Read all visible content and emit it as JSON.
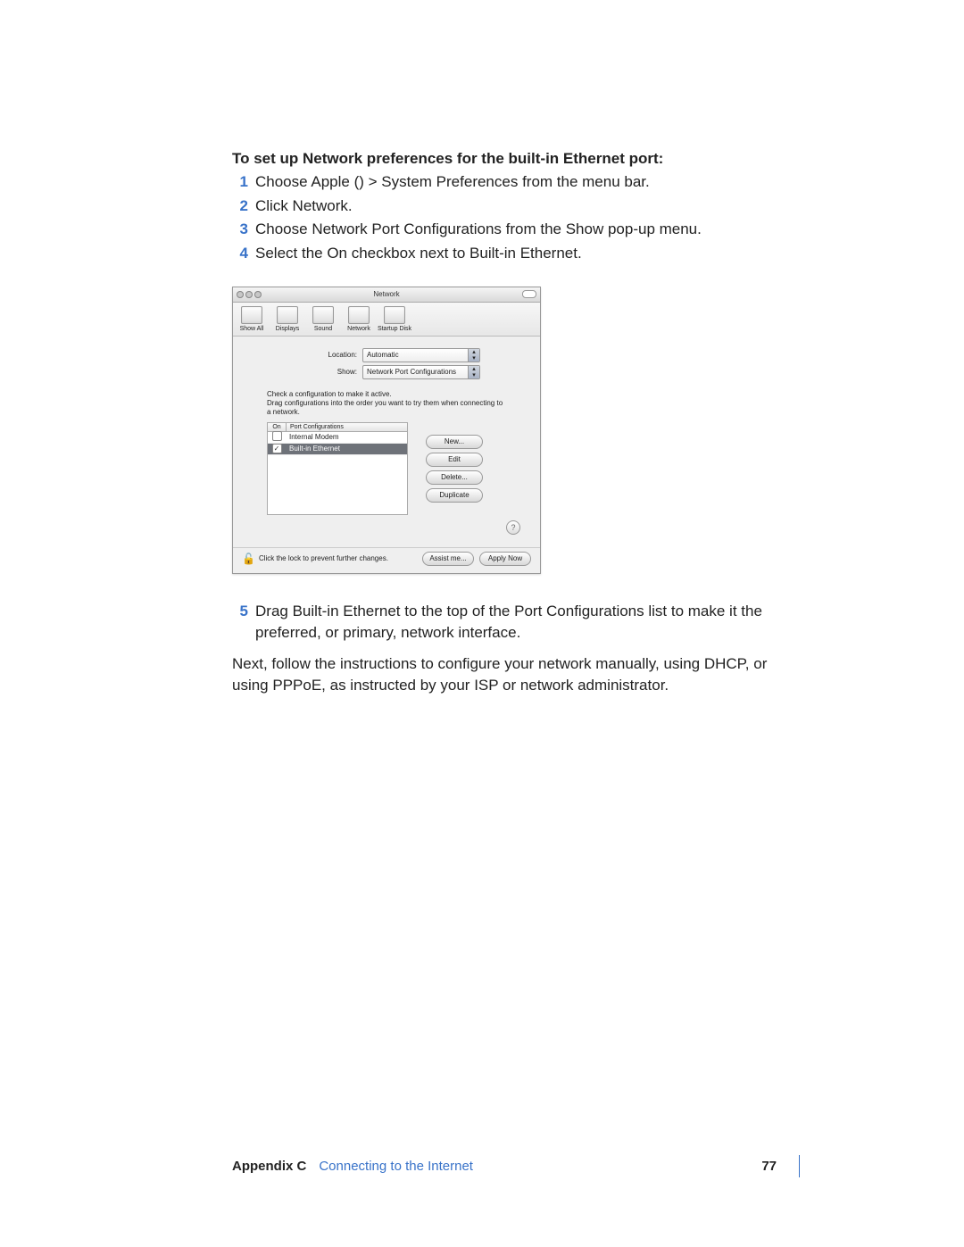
{
  "heading": "To set up Network preferences for the built-in Ethernet port:",
  "steps": [
    "Choose Apple () > System Preferences from the menu bar.",
    "Click Network.",
    "Choose Network Port Configurations from the Show pop-up menu.",
    "Select the On checkbox next to Built-in Ethernet."
  ],
  "step5": "Drag Built-in Ethernet to the top of the Port Configurations list to make it the preferred, or primary, network interface.",
  "para_after": "Next, follow the instructions to configure your network manually, using DHCP, or using PPPoE, as instructed by your ISP or network administrator.",
  "footer": {
    "appendix": "Appendix C",
    "chapter": "Connecting to the Internet",
    "page": "77"
  },
  "window": {
    "title": "Network",
    "toolbar": [
      "Show All",
      "Displays",
      "Sound",
      "Network",
      "Startup Disk"
    ],
    "location_label": "Location:",
    "location_value": "Automatic",
    "show_label": "Show:",
    "show_value": "Network Port Configurations",
    "hint": "Check a configuration to make it active.\nDrag configurations into the order you want to try them when connecting to a network.",
    "col_on": "On",
    "col_port": "Port Configurations",
    "rows": [
      {
        "on": false,
        "name": "Internal Modem",
        "selected": false
      },
      {
        "on": true,
        "name": "Built-in Ethernet",
        "selected": true
      }
    ],
    "buttons": {
      "new": "New...",
      "edit": "Edit",
      "delete": "Delete...",
      "duplicate": "Duplicate"
    },
    "lock_text": "Click the lock to prevent further changes.",
    "assist": "Assist me...",
    "apply": "Apply Now",
    "help": "?"
  }
}
